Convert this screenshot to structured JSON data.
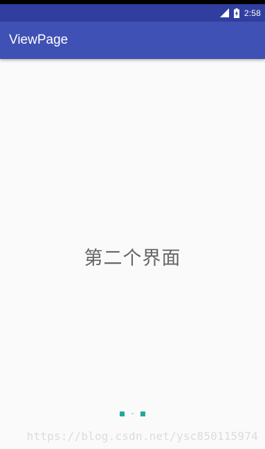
{
  "status_bar": {
    "time": "2:58",
    "icons": [
      "signal-icon",
      "battery-charging-icon"
    ]
  },
  "app_bar": {
    "title": "ViewPage"
  },
  "pager": {
    "page_text": "第二个界面",
    "pages_count": 3,
    "current_page_index": 1
  },
  "watermark": {
    "text": "https://blog.csdn.net/ysc850115974"
  },
  "colors": {
    "status_bar": "#303f9f",
    "app_bar": "#3f51b5",
    "indicator": "#26a69a",
    "background": "#fafafa"
  }
}
